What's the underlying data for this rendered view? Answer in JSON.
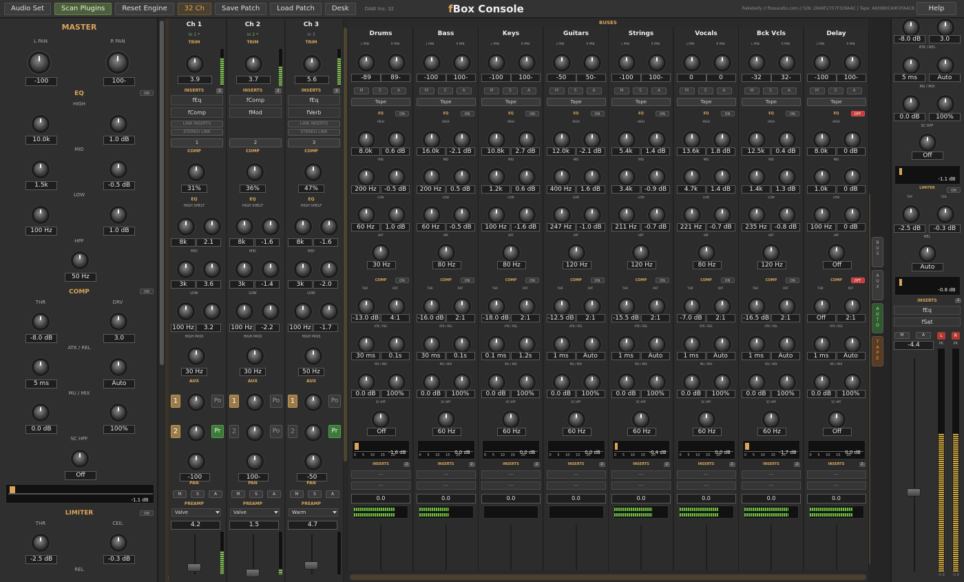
{
  "toolbar": {
    "audio_set": "Audio Set",
    "scan_plugins": "Scan Plugins",
    "reset_engine": "Reset Engine",
    "channels": "32 Ch",
    "save_patch": "Save Patch",
    "load_patch": "Load Patch",
    "desk": "Desk",
    "daw_ins": "DAW Ins: 32",
    "title_f": "f",
    "title_rest": "Box Console",
    "serial": "Rakebelly // fboxaudio.com // S/N: 29A9F2757F329AAC | Tape: A60980CA9F2FAAC8",
    "help": "Help"
  },
  "master": {
    "title": "MASTER",
    "l_pan_label": "L PAN",
    "r_pan_label": "R PAN",
    "l_pan": "-100",
    "r_pan": "100-",
    "eq_label": "EQ",
    "eq_on": "ON",
    "high_label": "HIGH",
    "high_freq": "10.0k",
    "high_gain": "1.0 dB",
    "mid_label": "MID",
    "mid_freq": "1.5k",
    "mid_gain": "-0.5 dB",
    "low_label": "LOW",
    "low_freq": "100 Hz",
    "low_gain": "1.0 dB",
    "hpf_label": "HPF",
    "hpf": "50 Hz",
    "comp_label": "COMP",
    "comp_on": "ON",
    "thr_label": "THR",
    "drv_label": "DRV",
    "thr": "-8.0 dB",
    "drv": "3.0",
    "atk_rel_label": "ATK / REL",
    "atk": "5 ms",
    "rel": "Auto",
    "mu_mix_label": "MU / MIX",
    "mu": "0.0 dB",
    "mix": "100%",
    "schpf_label": "SC HPF",
    "schpf": "Off",
    "gr": "-1.1 dB",
    "limiter_label": "LIMITER",
    "limiter_on": "ON",
    "lim_thr_label": "THR",
    "lim_ceil_label": "CEIL",
    "lim_thr": "-2.5 dB",
    "lim_ceil": "-0.3 dB",
    "lim_rel_label": "REL"
  },
  "channel_labels": {
    "trim": "TRIM",
    "inserts": "INSERTS",
    "link_inserts": "LINK INSERTS",
    "stereo_link": "STEREO LINK",
    "comp": "COMP",
    "eq": "EQ",
    "high_shelf": "HIGH SHELF",
    "mid": "MID",
    "low": "LOW",
    "high_pass": "HIGH PASS",
    "aux": "AUX",
    "pan": "PAN",
    "preamp": "PREAMP",
    "m": "M",
    "s": "S",
    "a": "A"
  },
  "channels": [
    {
      "name": "Ch 1",
      "input": "In 1 *",
      "trim": "3.9",
      "insert_count": "2",
      "ins1": "fEq",
      "ins2": "fComp",
      "num": "1",
      "comp": "31%",
      "hs_f": "8k",
      "hs_g": "2.1",
      "mid_f": "3k",
      "mid_g": "3.6",
      "low_f": "100 Hz",
      "low_g": "3.2",
      "hp": "30 Hz",
      "aux1": "1",
      "aux1_mode": "Po",
      "aux2": "2",
      "aux2_mode": "Pr",
      "pan": "-100",
      "preamp": "Valve",
      "out": "4.2"
    },
    {
      "name": "Ch 2",
      "input": "In 2 *",
      "trim": "3.7",
      "insert_count": "2",
      "ins1": "fComp",
      "ins2": "fMod",
      "num": "2",
      "comp": "36%",
      "hs_f": "8k",
      "hs_g": "-1.6",
      "mid_f": "3k",
      "mid_g": "-1.4",
      "low_f": "100 Hz",
      "low_g": "-2.2",
      "hp": "30 Hz",
      "aux1": "1",
      "aux1_mode": "Po",
      "aux2": "2",
      "aux2_mode": "Po",
      "pan": "100-",
      "preamp": "Valve",
      "out": "1.5"
    },
    {
      "name": "Ch 3",
      "input": "In 3",
      "trim": "5.6",
      "insert_count": "2",
      "ins1": "fEq",
      "ins2": "fVerb",
      "num": "3",
      "comp": "47%",
      "hs_f": "8k",
      "hs_g": "-1.6",
      "mid_f": "3k",
      "mid_g": "-2.0",
      "low_f": "100 Hz",
      "low_g": "-1.7",
      "hp": "50 Hz",
      "aux1": "1",
      "aux1_mode": "Po",
      "aux2": "2",
      "aux2_mode": "Pr",
      "pan": "-50",
      "preamp": "Warm",
      "out": "4.7"
    }
  ],
  "bus_labels": {
    "header": "BUSES",
    "l_pan": "L PAN",
    "r_pan": "R PAN",
    "tape": "Tape",
    "eq": "EQ",
    "high": "HIGH",
    "mid": "MID",
    "low": "LOW",
    "hpf": "HPF",
    "comp": "COMP",
    "thr": "THR",
    "rat": "RAT",
    "atk_rel": "ATK / REL",
    "mu_mix": "MU / MIX",
    "sc_hpf": "SC HPF",
    "inserts": "INSERTS",
    "insert_count": "2",
    "empty_slot": "---",
    "m": "M",
    "s": "S",
    "a": "A",
    "ticks": [
      "0",
      "5",
      "10",
      "15",
      "20"
    ]
  },
  "buses": [
    {
      "name": "Drums",
      "lpan": "-89",
      "rpan": "89-",
      "eq_on": "ON",
      "hf": "8.0k",
      "hg": "0.6 dB",
      "mf": "200 Hz",
      "mg": "-0.5 dB",
      "lf": "60 Hz",
      "lg": "1.0 dB",
      "hpf": "30 Hz",
      "comp_on": "ON",
      "thr": "-13.0 dB",
      "rat": "4:1",
      "atk": "30 ms",
      "rel": "0.1s",
      "mu": "0.0 dB",
      "mix": "100%",
      "schpf": "Off",
      "gr": "-1.6 dB",
      "gr_level": 0.08,
      "fader": "0.0",
      "level": 0.75
    },
    {
      "name": "Bass",
      "lpan": "-100",
      "rpan": "100-",
      "eq_on": "ON",
      "hf": "16.0k",
      "hg": "-2.1 dB",
      "mf": "200 Hz",
      "mg": "0.5 dB",
      "lf": "60 Hz",
      "lg": "-0.5 dB",
      "hpf": "80 Hz",
      "comp_on": "ON",
      "thr": "-16.0 dB",
      "rat": "2:1",
      "atk": "30 ms",
      "rel": "0.1s",
      "mu": "0.0 dB",
      "mix": "100%",
      "schpf": "60 Hz",
      "gr": "0.0 dB",
      "gr_level": 0.0,
      "fader": "0.0",
      "level": 0.55
    },
    {
      "name": "Keys",
      "lpan": "-100",
      "rpan": "100-",
      "eq_on": "ON",
      "hf": "10.8k",
      "hg": "2.7 dB",
      "mf": "1.2k",
      "mg": "0.6 dB",
      "lf": "100 Hz",
      "lg": "-1.6 dB",
      "hpf": "80 Hz",
      "comp_on": "ON",
      "thr": "-18.0 dB",
      "rat": "2:1",
      "atk": "0.1 ms",
      "rel": "1.2s",
      "mu": "0.0 dB",
      "mix": "100%",
      "schpf": "60 Hz",
      "gr": "0.0 dB",
      "gr_level": 0.0,
      "fader": "0.0",
      "level": 0.0
    },
    {
      "name": "Guitars",
      "lpan": "-50",
      "rpan": "50-",
      "eq_on": "ON",
      "hf": "12.0k",
      "hg": "-2.1 dB",
      "mf": "400 Hz",
      "mg": "1.6 dB",
      "lf": "247 Hz",
      "lg": "-1.0 dB",
      "hpf": "120 Hz",
      "comp_on": "ON",
      "thr": "-12.5 dB",
      "rat": "2:1",
      "atk": "1 ms",
      "rel": "Auto",
      "mu": "0.0 dB",
      "mix": "100%",
      "schpf": "60 Hz",
      "gr": "0.0 dB",
      "gr_level": 0.0,
      "fader": "0.0",
      "level": 0.0
    },
    {
      "name": "Strings",
      "lpan": "-100",
      "rpan": "100-",
      "eq_on": "ON",
      "hf": "5.4k",
      "hg": "1.4 dB",
      "mf": "3.4k",
      "mg": "-0.9 dB",
      "lf": "211 Hz",
      "lg": "-0.7 dB",
      "hpf": "120 Hz",
      "comp_on": "ON",
      "thr": "-15.5 dB",
      "rat": "2:1",
      "atk": "1 ms",
      "rel": "Auto",
      "mu": "0.0 dB",
      "mix": "100%",
      "schpf": "60 Hz",
      "gr": "-0.4 dB",
      "gr_level": 0.02,
      "fader": "0.0",
      "level": 0.7
    },
    {
      "name": "Vocals",
      "lpan": "0",
      "rpan": "0",
      "eq_on": "ON",
      "hf": "13.6k",
      "hg": "1.8 dB",
      "mf": "4.7k",
      "mg": "1.4 dB",
      "lf": "221 Hz",
      "lg": "-0.7 dB",
      "hpf": "80 Hz",
      "comp_on": "ON",
      "thr": "-7.0 dB",
      "rat": "2:1",
      "atk": "1 ms",
      "rel": "Auto",
      "mu": "0.0 dB",
      "mix": "100%",
      "schpf": "60 Hz",
      "gr": "0.0 dB",
      "gr_level": 0.0,
      "fader": "0.0",
      "level": 0.72
    },
    {
      "name": "Bck Vcls",
      "lpan": "-32",
      "rpan": "32-",
      "eq_on": "ON",
      "hf": "12.5k",
      "hg": "0.4 dB",
      "mf": "1.4k",
      "mg": "1.3 dB",
      "lf": "235 Hz",
      "lg": "-0.8 dB",
      "hpf": "120 Hz",
      "comp_on": "ON",
      "thr": "-16.5 dB",
      "rat": "2:1",
      "atk": "1 ms",
      "rel": "Auto",
      "mu": "0.0 dB",
      "mix": "100%",
      "schpf": "60 Hz",
      "gr": "-1.7 dB",
      "gr_level": 0.08,
      "fader": "0.0",
      "level": 0.82
    },
    {
      "name": "Delay",
      "lpan": "-100",
      "rpan": "100-",
      "eq_on": "OFF",
      "hf": "8.0k",
      "hg": "0 dB",
      "mf": "1.0k",
      "mg": "0 dB",
      "lf": "100 Hz",
      "lg": "0 dB",
      "hpf": "Off",
      "comp_on": "OFF",
      "thr": "Off",
      "rat": "2:1",
      "atk": "1 ms",
      "rel": "Auto",
      "mu": "0.0 dB",
      "mix": "100%",
      "schpf": "Off",
      "gr": "0.0 dB",
      "gr_level": 0.0,
      "fader": "0.0",
      "level": 0.8
    }
  ],
  "side_tabs": [
    "BUS",
    "AUX",
    "AUTO",
    "TAPE"
  ],
  "right": {
    "drv": "-8.0 dB",
    "drv2": "3.0",
    "atk_rel": "ATK / REL",
    "atk": "5 ms",
    "rel": "Auto",
    "mu_mix": "MU / MIX",
    "mu": "0.0 dB",
    "mix": "100%",
    "schpf_label": "SC HPF",
    "schpf": "Off",
    "gr": "-1.1 dB",
    "limiter": "LIMITER",
    "limiter_on": "ON",
    "thr_label": "THR",
    "ceil_label": "CEIL",
    "thr": "-2.5 dB",
    "ceil": "-0.3 dB",
    "rel_label": "REL",
    "lim_rel": "Auto",
    "lim_gr": "-0.8 dB",
    "inserts": "INSERTS",
    "insert_count": "2",
    "ins1": "fEq",
    "ins2": "fSat",
    "m": "M",
    "a": "A",
    "fader": "-4.4",
    "l": "L",
    "r": "R",
    "pk": "PK",
    "peak_l": "-5.9",
    "peak_r": "-5.9",
    "level_l": 0.62,
    "level_r": 0.62
  }
}
